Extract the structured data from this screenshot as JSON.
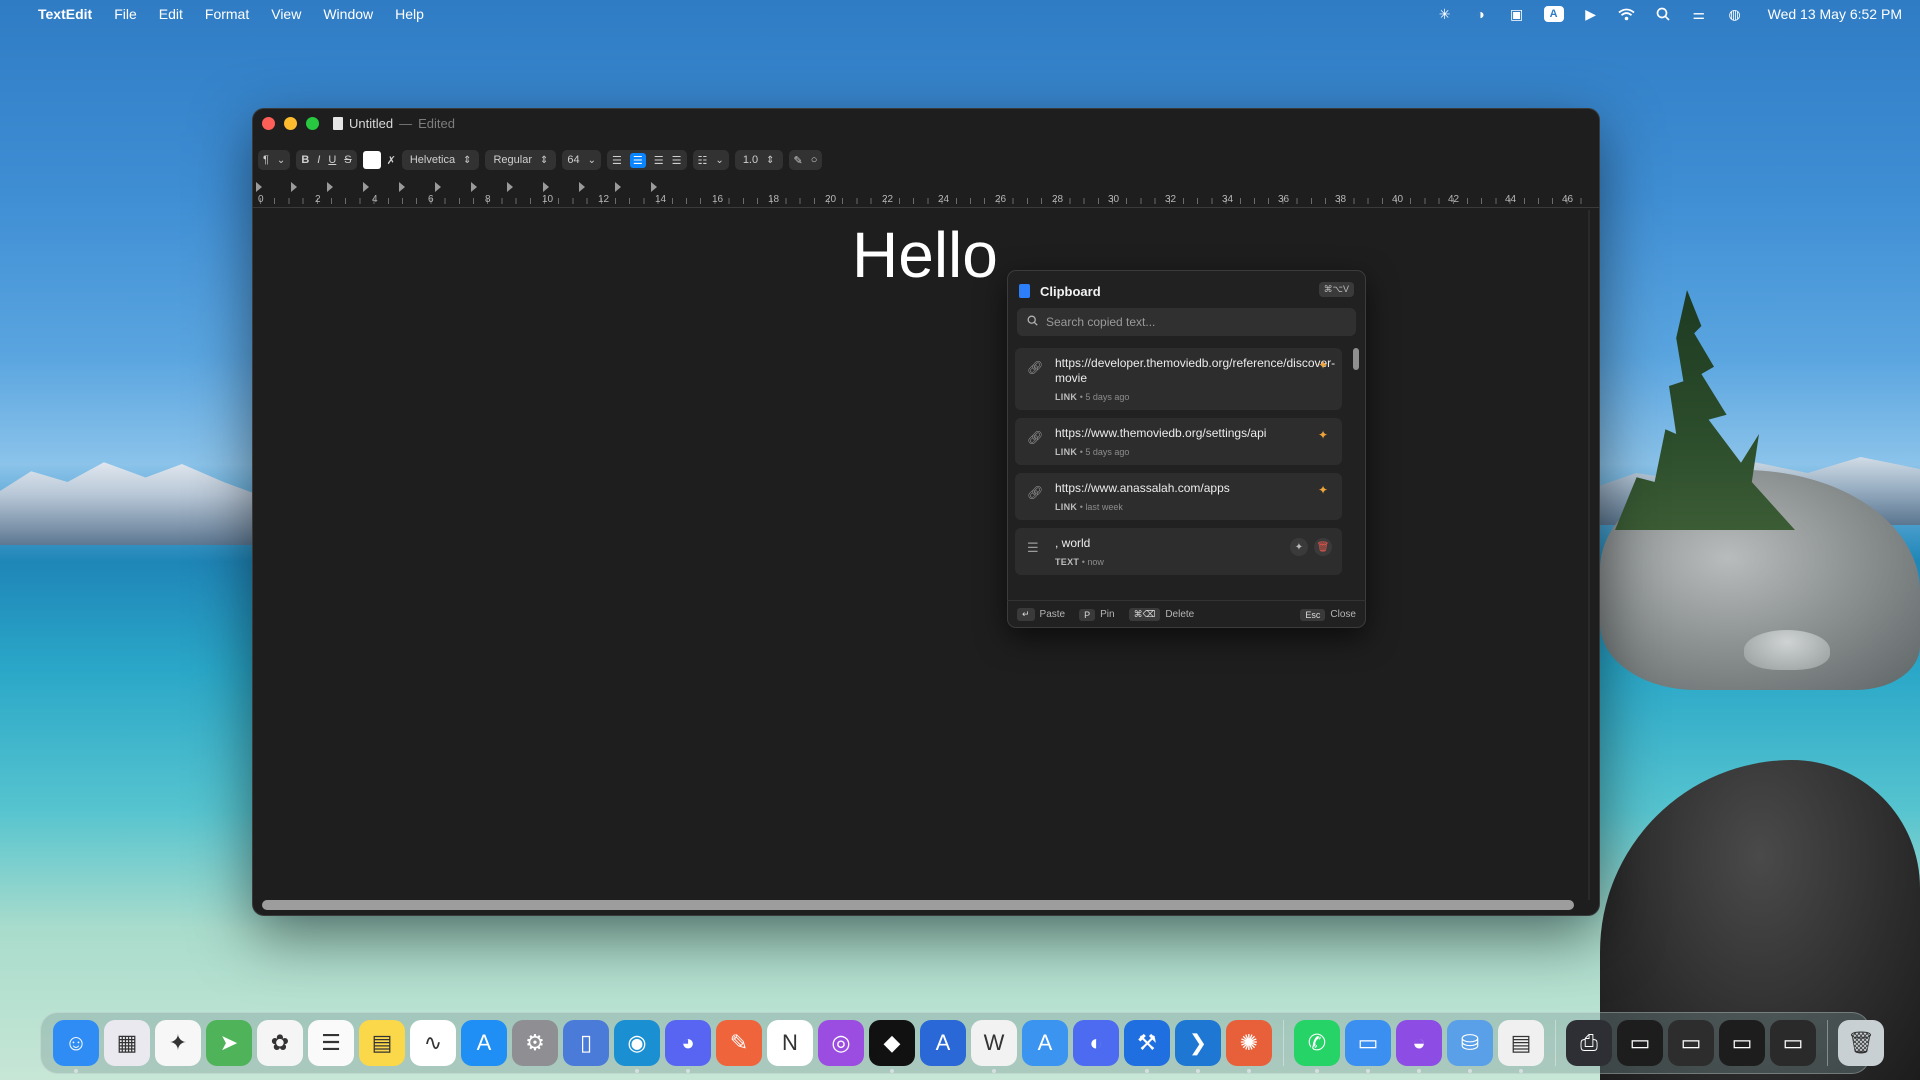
{
  "menubar": {
    "app_name": "TextEdit",
    "items": [
      "File",
      "Edit",
      "Format",
      "View",
      "Window",
      "Help"
    ],
    "status_icons": [
      "asterisk-icon",
      "network-icon",
      "clipboard-icon",
      "input-source-icon",
      "play-icon",
      "wifi-icon",
      "search-icon",
      "control-center-icon",
      "siri-icon"
    ],
    "input_source": "A",
    "clock": "Wed 13 May  6:52 PM"
  },
  "window": {
    "title": "Untitled",
    "separator": "—",
    "status": "Edited"
  },
  "toolbar": {
    "paragraph_style": "¶",
    "bold": "B",
    "italic": "I",
    "underline": "U",
    "strikethrough": "S",
    "font_family": "Helvetica",
    "font_style": "Regular",
    "font_size": "64",
    "line_spacing": "1.0",
    "text_color": "#ffffff"
  },
  "ruler": {
    "labels": [
      "0",
      "2",
      "4",
      "6",
      "8",
      "10",
      "12",
      "14",
      "16",
      "18",
      "20",
      "22",
      "24",
      "26",
      "28",
      "30",
      "32",
      "34",
      "36",
      "38",
      "40",
      "42",
      "44",
      "46"
    ]
  },
  "document": {
    "text": "Hello"
  },
  "clipboard": {
    "title": "Clipboard",
    "shortcut": "⌘⌥V",
    "search_placeholder": "Search copied text...",
    "items": [
      {
        "kind": "LINK",
        "text": "https://developer.themoviedb.org/reference/discover-movie",
        "age": "5 days ago",
        "pinned": true
      },
      {
        "kind": "LINK",
        "text": "https://www.themoviedb.org/settings/api",
        "age": "5 days ago",
        "pinned": true
      },
      {
        "kind": "LINK",
        "text": "https://www.anassalah.com/apps",
        "age": "last week",
        "pinned": true
      },
      {
        "kind": "TEXT",
        "text": ", world",
        "age": "now",
        "pinned": false
      }
    ],
    "footer": {
      "paste_key": "↵",
      "paste_label": "Paste",
      "pin_key": "P",
      "pin_label": "Pin",
      "delete_key": "⌘⌫",
      "delete_label": "Delete",
      "close_key": "Esc",
      "close_label": "Close"
    },
    "meta_separator": "•"
  },
  "dock": {
    "apps": [
      {
        "name": "finder",
        "color": "#2f8cf5",
        "glyph": "☺"
      },
      {
        "name": "launchpad",
        "color": "#e9e9ef",
        "glyph": "▦"
      },
      {
        "name": "sketch-app",
        "color": "#f7f7f7",
        "glyph": "✦"
      },
      {
        "name": "maps",
        "color": "#4fb35a",
        "glyph": "➤"
      },
      {
        "name": "photos",
        "color": "#f5f5f5",
        "glyph": "✿"
      },
      {
        "name": "reminders",
        "color": "#fafafa",
        "glyph": "☰"
      },
      {
        "name": "notes",
        "color": "#fbd74a",
        "glyph": "▤"
      },
      {
        "name": "freeform",
        "color": "#ffffff",
        "glyph": "∿"
      },
      {
        "name": "app-store",
        "color": "#1f8ef5",
        "glyph": "A"
      },
      {
        "name": "system-settings",
        "color": "#8e8e93",
        "glyph": "⚙"
      },
      {
        "name": "simulator",
        "color": "#4a7bd9",
        "glyph": "▯"
      },
      {
        "name": "edge",
        "color": "#1a8fd2",
        "glyph": "◉"
      },
      {
        "name": "discord",
        "color": "#5865f2",
        "glyph": "◕"
      },
      {
        "name": "swift-playgrounds",
        "color": "#f0643c",
        "glyph": "✎"
      },
      {
        "name": "notion",
        "color": "#ffffff",
        "glyph": "N"
      },
      {
        "name": "podcasts",
        "color": "#9b4de1",
        "glyph": "◎"
      },
      {
        "name": "cursor",
        "color": "#111111",
        "glyph": "◆"
      },
      {
        "name": "instruments",
        "color": "#2a68d8",
        "glyph": "A"
      },
      {
        "name": "writer",
        "color": "#f2f2f2",
        "glyph": "W"
      },
      {
        "name": "xcode-app-store",
        "color": "#3b94f0",
        "glyph": "A"
      },
      {
        "name": "proxyman",
        "color": "#4d6bf0",
        "glyph": "◐"
      },
      {
        "name": "xcode",
        "color": "#1f6fe0",
        "glyph": "⚒"
      },
      {
        "name": "vscode",
        "color": "#1e77d2",
        "glyph": "❯"
      },
      {
        "name": "claude",
        "color": "#e8603a",
        "glyph": "✺"
      },
      {
        "name": "whatsapp",
        "color": "#25d366",
        "glyph": "✆"
      },
      {
        "name": "files",
        "color": "#3a8ff0",
        "glyph": "▭"
      },
      {
        "name": "github-desktop",
        "color": "#8d4de4",
        "glyph": "◒"
      },
      {
        "name": "disk-utility",
        "color": "#5aa0e8",
        "glyph": "⛁"
      },
      {
        "name": "textedit",
        "color": "#f0f0f0",
        "glyph": "▤"
      },
      {
        "name": "printer",
        "color": "#2d2f34",
        "glyph": "⎙"
      },
      {
        "name": "window-thumbnail-1",
        "color": "#1d1d1d",
        "glyph": "▭"
      },
      {
        "name": "window-thumbnail-2",
        "color": "#2d2d2d",
        "glyph": "▭"
      },
      {
        "name": "window-thumbnail-3",
        "color": "#1d1d1d",
        "glyph": "▭"
      },
      {
        "name": "window-thumbnail-4",
        "color": "#2a2a2a",
        "glyph": "▭"
      },
      {
        "name": "trash",
        "color": "#c9d0d4",
        "glyph": "🗑"
      }
    ]
  }
}
